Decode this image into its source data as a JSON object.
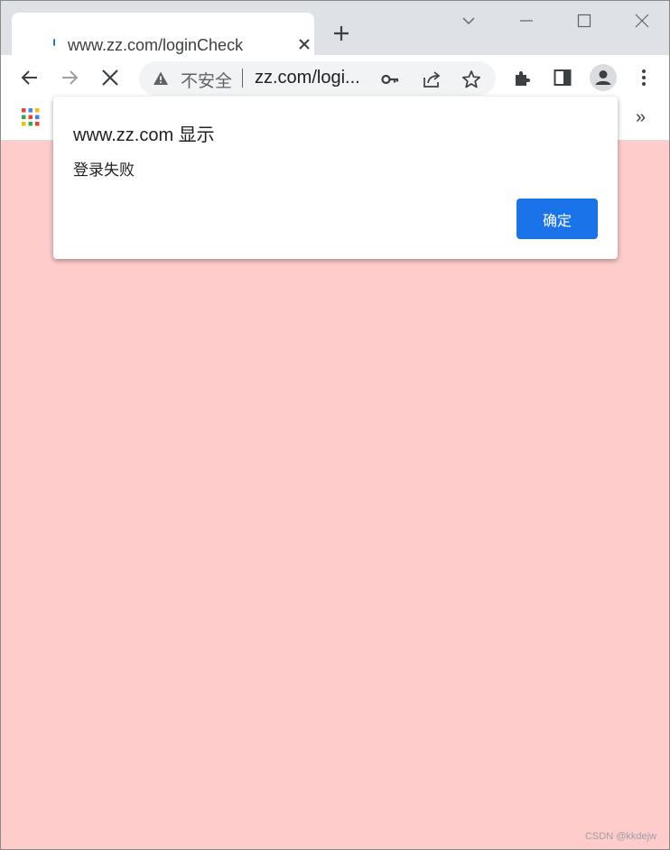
{
  "browser": {
    "tab": {
      "title": "www.zz.com/loginCheck"
    },
    "omnibox": {
      "security_label": "不安全",
      "url": "zz.com/logi..."
    },
    "bookmarks": {
      "overflow_label": "»"
    }
  },
  "dialog": {
    "title": "www.zz.com 显示",
    "message": "登录失败",
    "ok_label": "确定"
  },
  "page": {
    "background": "#ffcccc",
    "watermark": "CSDN @kkdejw"
  },
  "colors": {
    "accent": "#1a73e8",
    "tabstrip": "#dee1e6"
  }
}
